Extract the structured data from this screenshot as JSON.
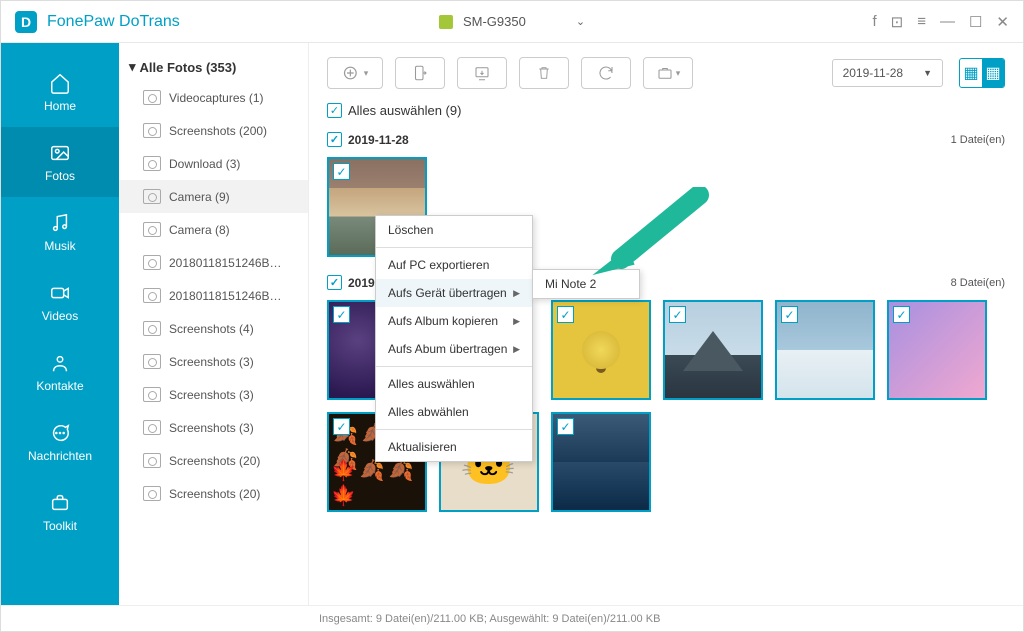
{
  "app": {
    "title": "FonePaw DoTrans"
  },
  "device": {
    "name": "SM-G9350"
  },
  "sidebar": [
    {
      "label": "Home"
    },
    {
      "label": "Fotos"
    },
    {
      "label": "Musik"
    },
    {
      "label": "Videos"
    },
    {
      "label": "Kontakte"
    },
    {
      "label": "Nachrichten"
    },
    {
      "label": "Toolkit"
    }
  ],
  "folders": {
    "header": "Alle Fotos (353)",
    "items": [
      "Videocaptures (1)",
      "Screenshots (200)",
      "Download (3)",
      "Camera (9)",
      "Camera (8)",
      "20180118151246B…",
      "20180118151246B…",
      "Screenshots (4)",
      "Screenshots (3)",
      "Screenshots (3)",
      "Screenshots (3)",
      "Screenshots (20)",
      "Screenshots (20)"
    ],
    "selectedIndex": 3
  },
  "toolbar": {
    "dateFilter": "2019-11-28"
  },
  "selectAll": {
    "label": "Alles auswählen (9)"
  },
  "groups": [
    {
      "date": "2019-11-28",
      "count": "1 Datei(en)"
    },
    {
      "date": "2019",
      "count": "8 Datei(en)"
    }
  ],
  "statusbar": "Insgesamt: 9 Datei(en)/211.00 KB; Ausgewählt: 9 Datei(en)/211.00 KB",
  "contextMenu": {
    "items": [
      "Löschen",
      "Auf PC exportieren",
      "Aufs Gerät übertragen",
      "Aufs Album kopieren",
      "Aufs Abum übertragen",
      "Alles auswählen",
      "Alles abwählen",
      "Aktualisieren"
    ],
    "submenu": "Mi Note 2"
  }
}
